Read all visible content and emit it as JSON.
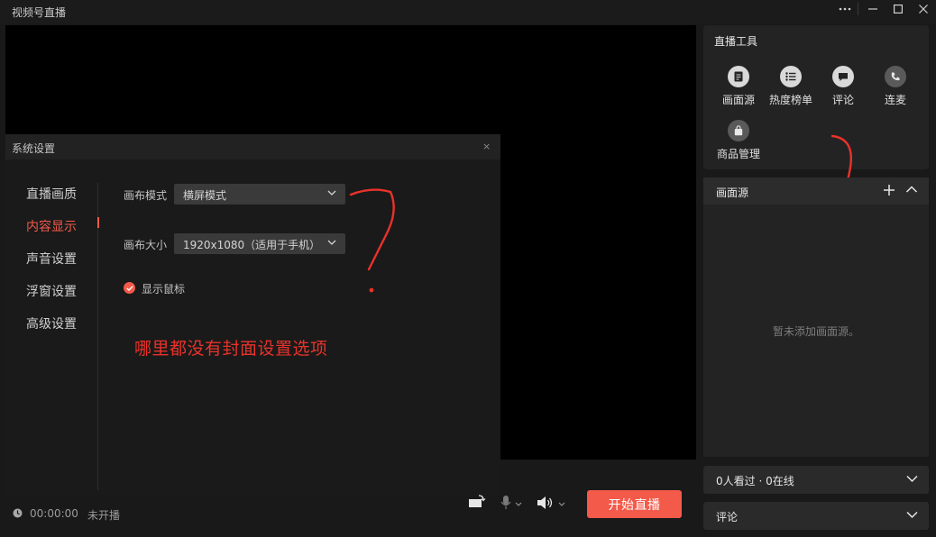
{
  "window": {
    "title": "视频号直播"
  },
  "bottom_bar": {
    "timer": "00:00:00",
    "status": "未开播",
    "start_label": "开始直播"
  },
  "tools": {
    "title": "直播工具",
    "items": [
      {
        "label": "画面源",
        "icon": "document-icon"
      },
      {
        "label": "热度榜单",
        "icon": "list-icon"
      },
      {
        "label": "评论",
        "icon": "comment-icon"
      },
      {
        "label": "连麦",
        "icon": "phone-icon"
      },
      {
        "label": "商品管理",
        "icon": "bag-icon"
      }
    ]
  },
  "source_panel": {
    "title": "画面源",
    "empty_text": "暂未添加画面源。"
  },
  "viewers": {
    "label": "0人看过 · 0在线"
  },
  "comments": {
    "label": "评论"
  },
  "settings": {
    "title": "系统设置",
    "close": "×",
    "nav": [
      {
        "label": "直播画质",
        "active": false
      },
      {
        "label": "内容显示",
        "active": true
      },
      {
        "label": "声音设置",
        "active": false
      },
      {
        "label": "浮窗设置",
        "active": false
      },
      {
        "label": "高级设置",
        "active": false
      }
    ],
    "canvas_mode_label": "画布模式",
    "canvas_mode_value": "横屏模式",
    "canvas_size_label": "画布大小",
    "canvas_size_value": "1920x1080（适用于手机）",
    "show_cursor_label": "显示鼠标",
    "show_cursor_checked": true
  },
  "annotation": {
    "text": "哪里都没有封面设置选项",
    "color": "#e9322a"
  },
  "colors": {
    "accent": "#f35a4a",
    "background": "#191919",
    "panel": "#232323"
  }
}
